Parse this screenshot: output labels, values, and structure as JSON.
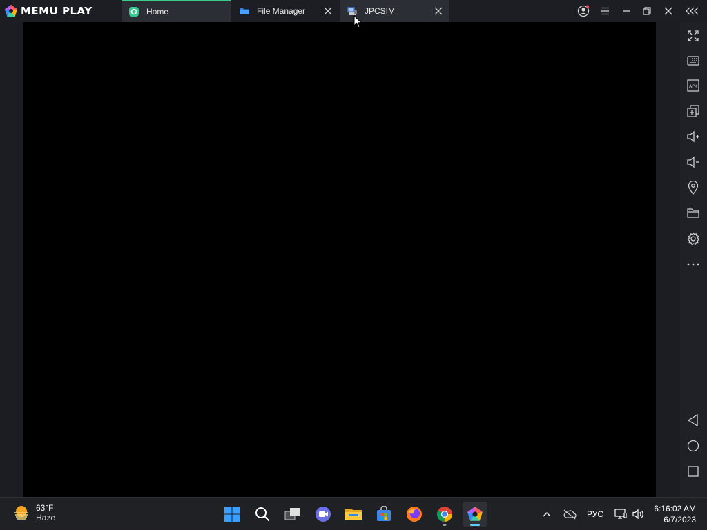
{
  "app": {
    "brand": "MEMU PLAY"
  },
  "tabs": [
    {
      "label": "Home",
      "icon": "memu-home-icon",
      "active": false
    },
    {
      "label": "File Manager",
      "icon": "folder-icon",
      "active": false
    },
    {
      "label": "JPCSIM",
      "icon": "jpcsim-icon",
      "active": true
    }
  ],
  "sidebar": {
    "items": [
      {
        "name": "fullscreen-icon"
      },
      {
        "name": "keyboard-icon"
      },
      {
        "name": "apk-install-icon"
      },
      {
        "name": "multi-instance-icon"
      },
      {
        "name": "volume-up-icon"
      },
      {
        "name": "volume-down-icon"
      },
      {
        "name": "location-icon"
      },
      {
        "name": "folder-icon"
      },
      {
        "name": "settings-icon"
      },
      {
        "name": "more-icon"
      }
    ],
    "nav": [
      "back-icon",
      "home-icon",
      "recents-icon"
    ]
  },
  "taskbar": {
    "weather": {
      "temp": "63°F",
      "condition": "Haze"
    },
    "apps": [
      "windows-start-icon",
      "search-icon",
      "task-view-icon",
      "meet-icon",
      "file-explorer-icon",
      "store-icon",
      "firefox-icon",
      "chrome-icon",
      "memu-icon"
    ],
    "language": "РУС",
    "time": "6:16:02 AM",
    "date": "6/7/2023"
  },
  "colors": {
    "accent_tab": "#38c98e",
    "taskbar_active": "#60cdff",
    "screen": "#000000"
  }
}
